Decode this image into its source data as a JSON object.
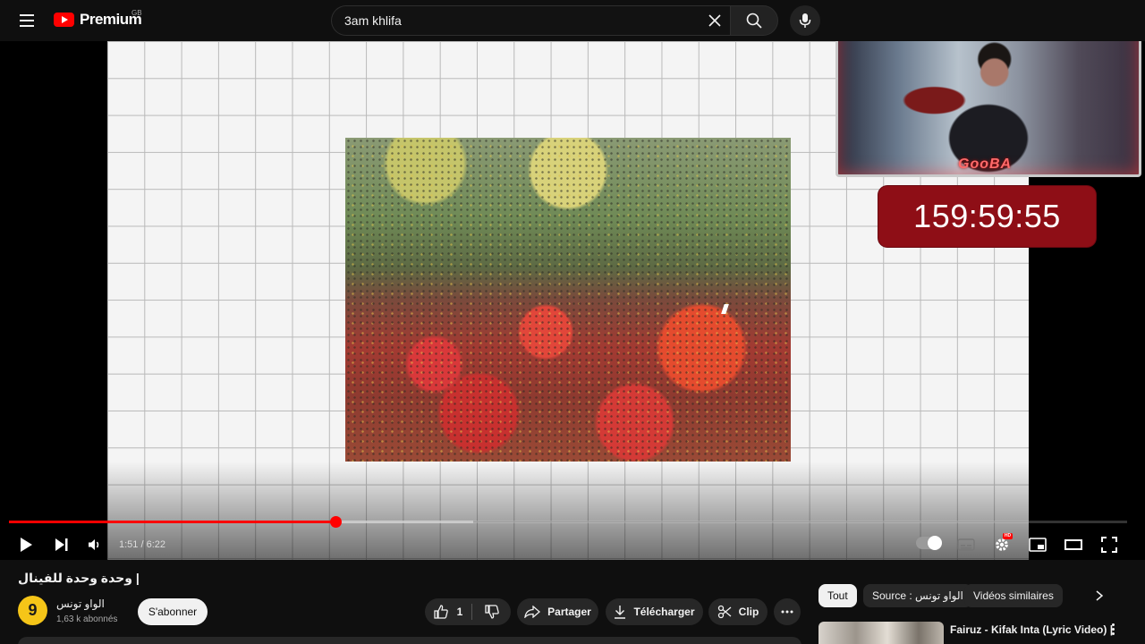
{
  "header": {
    "logo_text": "Premium",
    "logo_region": "GB",
    "search_query": "3am khlifa"
  },
  "overlay": {
    "webcam_tag": "GooBA",
    "timer": "159:59:55"
  },
  "player": {
    "time_display": "1:51 / 6:22",
    "played_fraction": 0.292,
    "buffered_fraction": 0.415,
    "hd_badge": "HD"
  },
  "video": {
    "title": "وحدة وحدة للفينال |"
  },
  "channel": {
    "name": "الواو تونس",
    "subscribers": "1,63 k abonnés",
    "subscribe_label": "S'abonner",
    "avatar_glyph": "9"
  },
  "actions": {
    "like_count": "1",
    "share_label": "Partager",
    "download_label": "Télécharger",
    "clip_label": "Clip"
  },
  "chips": [
    {
      "label": "Tout"
    },
    {
      "label": "Source : الواو تونس"
    },
    {
      "label": "Vidéos similaires"
    }
  ],
  "recommendations": [
    {
      "title": "Fairuz - Kifak Inta (Lyric Video) |"
    }
  ],
  "colors": {
    "accent_red": "#ff0000",
    "timer_bg": "#8e0e16",
    "background": "#0f0f0f"
  }
}
